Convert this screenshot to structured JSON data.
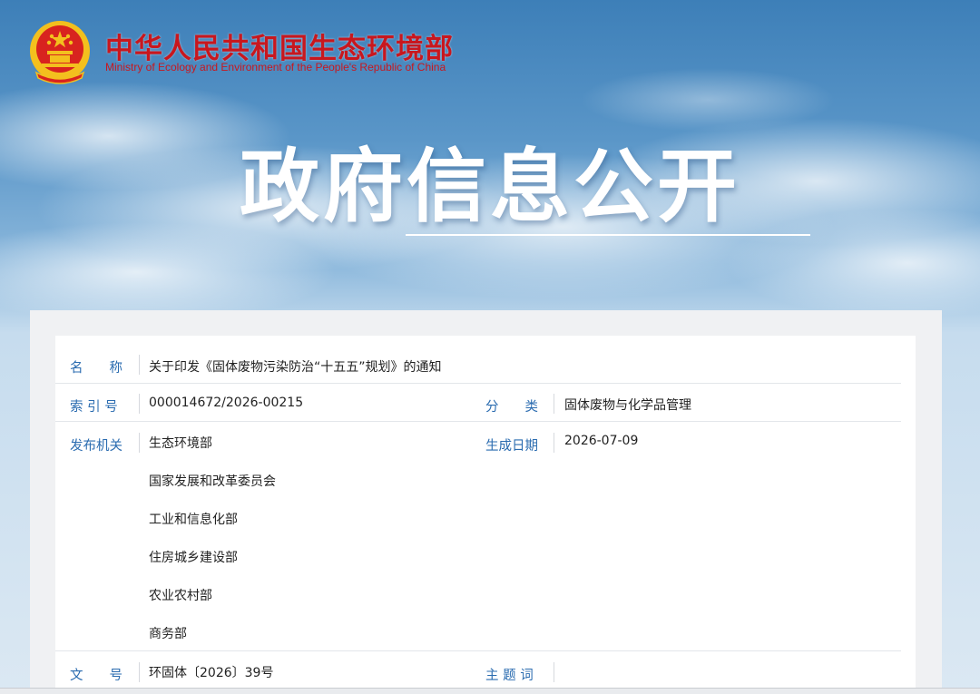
{
  "header": {
    "ministry_name_cn": "中华人民共和国生态环境部",
    "ministry_name_en": "Ministry of Ecology and Environment of the People's Republic of China",
    "emblem_icon": "national-emblem-icon"
  },
  "banner": {
    "title": "政府信息公开"
  },
  "colors": {
    "brand_red": "#c8171e",
    "label_blue": "#2b6cb0",
    "sky_top": "#3d7fb8"
  },
  "info": {
    "name_label": "名　　称",
    "name_value": "关于印发《固体废物污染防治“十五五”规划》的通知",
    "index_label": "索 引 号",
    "index_value": "000014672/2026-00215",
    "category_label": "分　　类",
    "category_value": "固体废物与化学品管理",
    "issuer_label": "发布机关",
    "issuers": [
      "生态环境部",
      "国家发展和改革委员会",
      "工业和信息化部",
      "住房城乡建设部",
      "农业农村部",
      "商务部"
    ],
    "date_label": "生成日期",
    "date_value": "2026-07-09",
    "docno_label": "文　　号",
    "docno_value": "环固体〔2026〕39号",
    "keywords_label": "主 题 词",
    "keywords_value": ""
  }
}
